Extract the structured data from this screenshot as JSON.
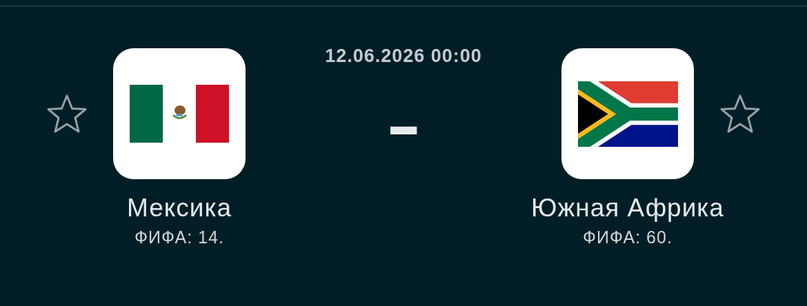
{
  "match": {
    "datetime": "12.06.2026 00:00",
    "score": "-"
  },
  "teams": [
    {
      "name": "Мексика",
      "fifa_rank": "ФИФА: 14.",
      "favorite": false
    },
    {
      "name": "Южная Африка",
      "fifa_rank": "ФИФА: 60.",
      "favorite": false
    }
  ]
}
